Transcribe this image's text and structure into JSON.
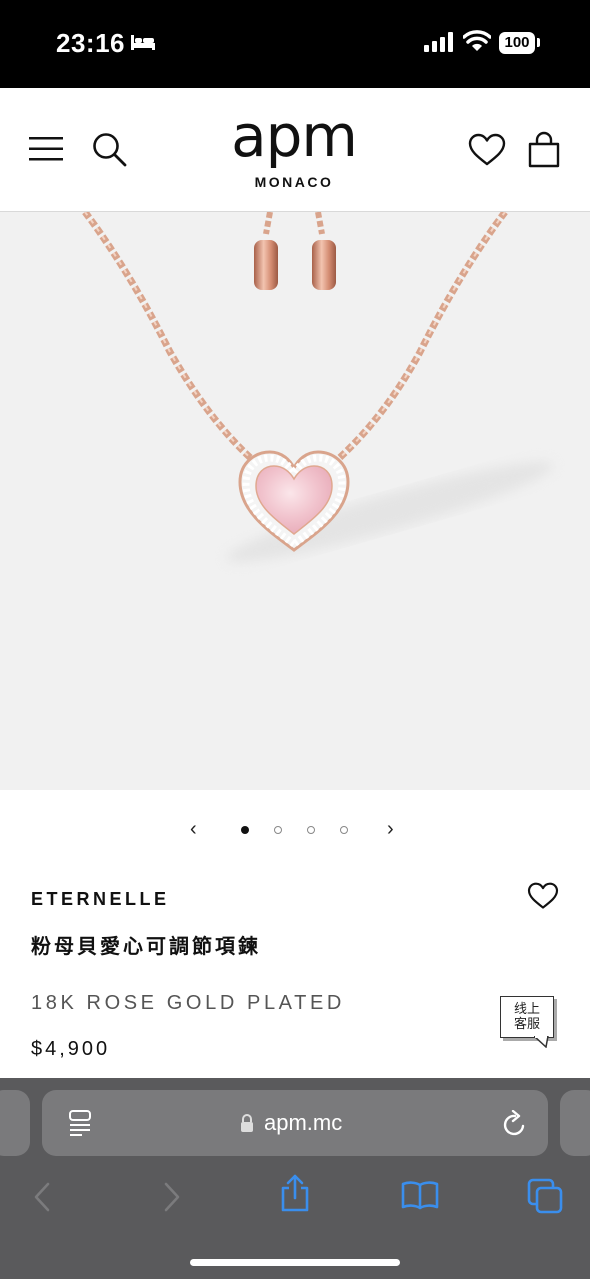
{
  "status_bar": {
    "time": "23:16",
    "battery": "100"
  },
  "header": {
    "brand": "apm",
    "brand_sub": "MONACO"
  },
  "carousel": {
    "slides": 4,
    "active_index": 0
  },
  "product": {
    "collection": "ETERNELLE",
    "name": "粉母貝愛心可調節項鍊",
    "material": "18K ROSE GOLD PLATED",
    "price": "$4,900"
  },
  "chat": {
    "label_line1": "线上",
    "label_line2": "客服"
  },
  "browser": {
    "url": "apm.mc"
  },
  "colors": {
    "rose_gold": "#d9a48c",
    "pearl_pink": "#f4cfd6",
    "icon_blue": "#3a8eed"
  }
}
